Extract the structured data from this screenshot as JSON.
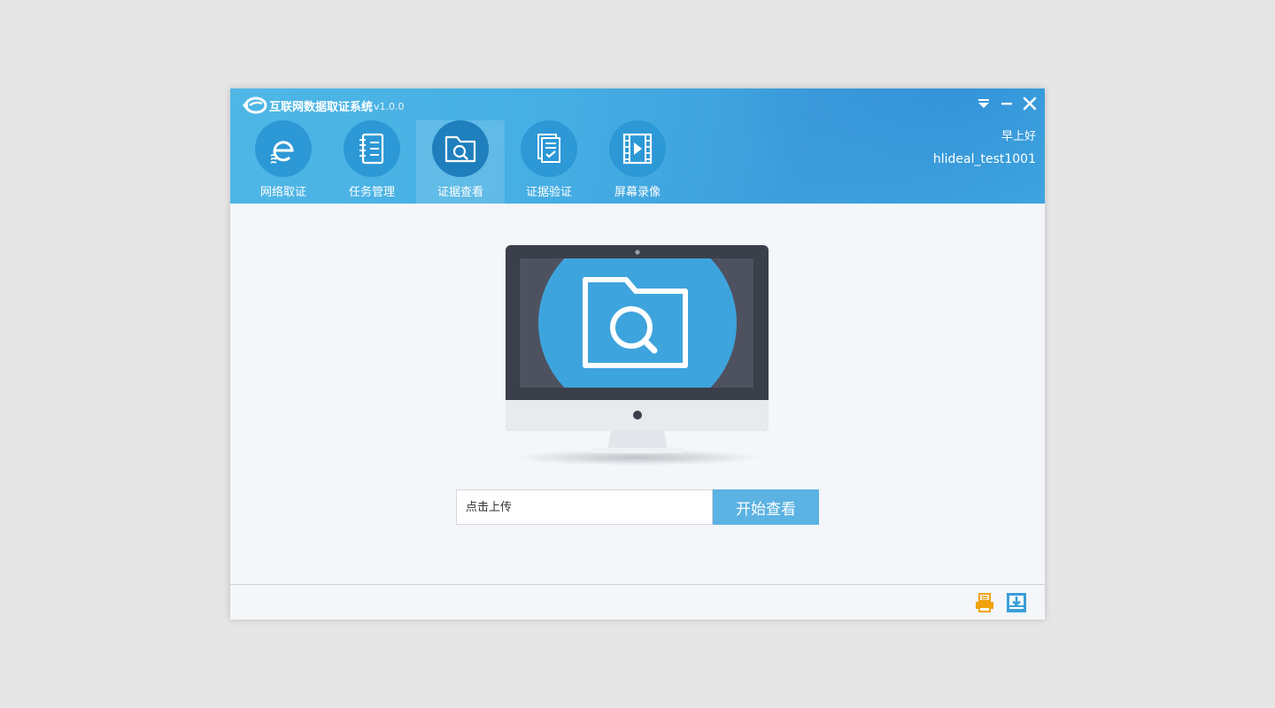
{
  "app": {
    "title": "互联网数据取证系统",
    "version": "v1.0.0"
  },
  "window_controls": {
    "menu_icon": "dropdown-menu-icon",
    "minimize_icon": "minimize-icon",
    "close_icon": "close-icon"
  },
  "nav": {
    "items": [
      {
        "label": "网络取证",
        "icon": "ie-browser-icon",
        "active": false
      },
      {
        "label": "任务管理",
        "icon": "notebook-icon",
        "active": false
      },
      {
        "label": "证据查看",
        "icon": "folder-search-icon",
        "active": true
      },
      {
        "label": "证据验证",
        "icon": "document-check-icon",
        "active": false
      },
      {
        "label": "屏幕录像",
        "icon": "film-play-icon",
        "active": false
      }
    ]
  },
  "user": {
    "greeting": "早上好",
    "username": "hlideal_test1001"
  },
  "main": {
    "illustration_icon": "monitor-folder-search-icon",
    "upload_placeholder": "点击上传",
    "start_button": "开始查看"
  },
  "footer": {
    "print_icon": "printer-icon",
    "download_icon": "download-icon"
  },
  "colors": {
    "header_blue": "#45aee3",
    "nav_circle": "#2c98d6",
    "nav_circle_active": "#1f7fbd",
    "button_blue": "#5bb2e3",
    "printer_orange": "#f0a20a",
    "download_blue": "#3a9fd8"
  }
}
